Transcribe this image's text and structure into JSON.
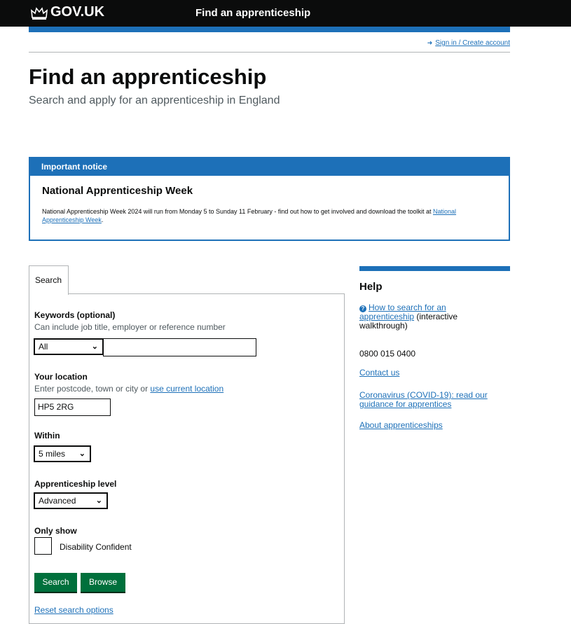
{
  "header": {
    "logo": "GOV.UK",
    "service_name": "Find an apprenticeship",
    "sign_in": "Sign in / Create account"
  },
  "page": {
    "title": "Find an apprenticeship",
    "lede": "Search and apply for an apprenticeship in England"
  },
  "notice": {
    "header": "Important notice",
    "title": "National Apprenticeship Week",
    "body": "National Apprenticeship Week 2024 will run from Monday 5 to Sunday 11 February - find out how to get involved and download the toolkit at ",
    "link": "National Apprenticeship Week",
    "end": "."
  },
  "search": {
    "tab": "Search",
    "keywords_label": "Keywords (optional)",
    "keywords_hint": "Can include job title, employer or reference number",
    "keywords_scope": "All",
    "keywords_value": "",
    "location_label": "Your location",
    "location_hint": "Enter postcode, town or city or ",
    "location_link": "use current location",
    "location_value": "HP5 2RG",
    "within_label": "Within",
    "within_value": "5 miles",
    "level_label": "Apprenticeship level",
    "level_value": "Advanced",
    "only_show_label": "Only show",
    "disability_label": "Disability Confident",
    "search_button": "Search",
    "browse_button": "Browse",
    "reset_link": "Reset search options"
  },
  "help": {
    "title": "Help",
    "walkthrough_link": "How to search for an apprenticeship",
    "walkthrough_suffix": " (interactive walkthrough)",
    "phone": "0800 015 0400",
    "contact": "Contact us",
    "covid": "Coronavirus (COVID-19): read our guidance for apprentices",
    "about": "About apprenticeships"
  }
}
